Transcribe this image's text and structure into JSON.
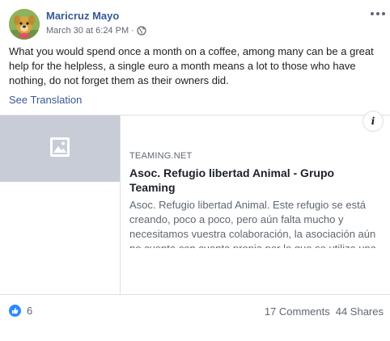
{
  "post": {
    "author": "Maricruz Mayo",
    "timestamp": "March 30 at 6:24 PM",
    "separator": "·",
    "privacy_icon": "globe-icon",
    "text": "What you would spend once a month on a coffee, among many can be a great help for the helpless, a single euro a month means a lot to those who have nothing, do not forget them as their owners did.",
    "see_translation": "See Translation"
  },
  "link_card": {
    "thumbnail_icon": "image-placeholder-icon",
    "info_label": "i",
    "domain": "TEAMING.NET",
    "title": "Asoc. Refugio libertad Animal - Grupo Teaming",
    "description": "Asoc. Refugio libertad Animal. Este refugio se está creando, poco a poco, pero aún falta mucho y necesitamos vuestra colaboración, la asociación aún no cuenta con cuenta propia por lo que se utiliza una cuenta de uno de los miembros de la asociación"
  },
  "footer": {
    "reaction_icon": "like-icon",
    "reaction_count": "6",
    "comments": "17 Comments",
    "shares": "44 Shares"
  },
  "colors": {
    "link_blue": "#385898",
    "like_blue": "#2d88ff",
    "secondary_text": "#606770",
    "thumbnail_bg": "#c7ccd6"
  }
}
